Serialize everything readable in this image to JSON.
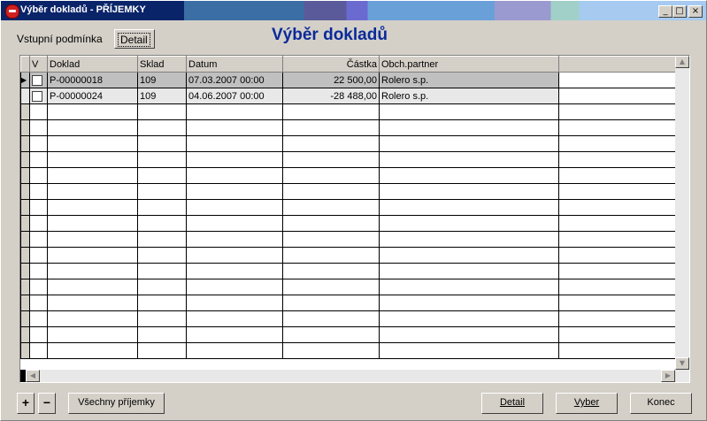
{
  "window": {
    "title": "Výběr dokladů - PŘÍJEMKY"
  },
  "tabs": [
    {
      "label": "Vstupní podmínka",
      "active": false
    },
    {
      "label": "Detail",
      "active": true
    }
  ],
  "heading": "Výběr dokladů",
  "grid": {
    "columns": [
      "V",
      "Doklad",
      "Sklad",
      "Datum",
      "Částka",
      "Obch.partner"
    ],
    "rows": [
      {
        "doklad": "P-00000018",
        "sklad": "109",
        "datum": "07.03.2007 00:00",
        "castka": "22 500,00",
        "partner": "Rolero s.p."
      },
      {
        "doklad": "P-00000024",
        "sklad": "109",
        "datum": "04.06.2007 00:00",
        "castka": "-28 488,00",
        "partner": "Rolero s.p."
      }
    ]
  },
  "buttons": {
    "plus": "+",
    "minus": "−",
    "all": "Všechny příjemky",
    "detail": "Detail",
    "vyber": "Vyber",
    "konec": "Konec"
  },
  "titlebar_buttons": {
    "min": "_",
    "max": "□",
    "close": "×"
  }
}
